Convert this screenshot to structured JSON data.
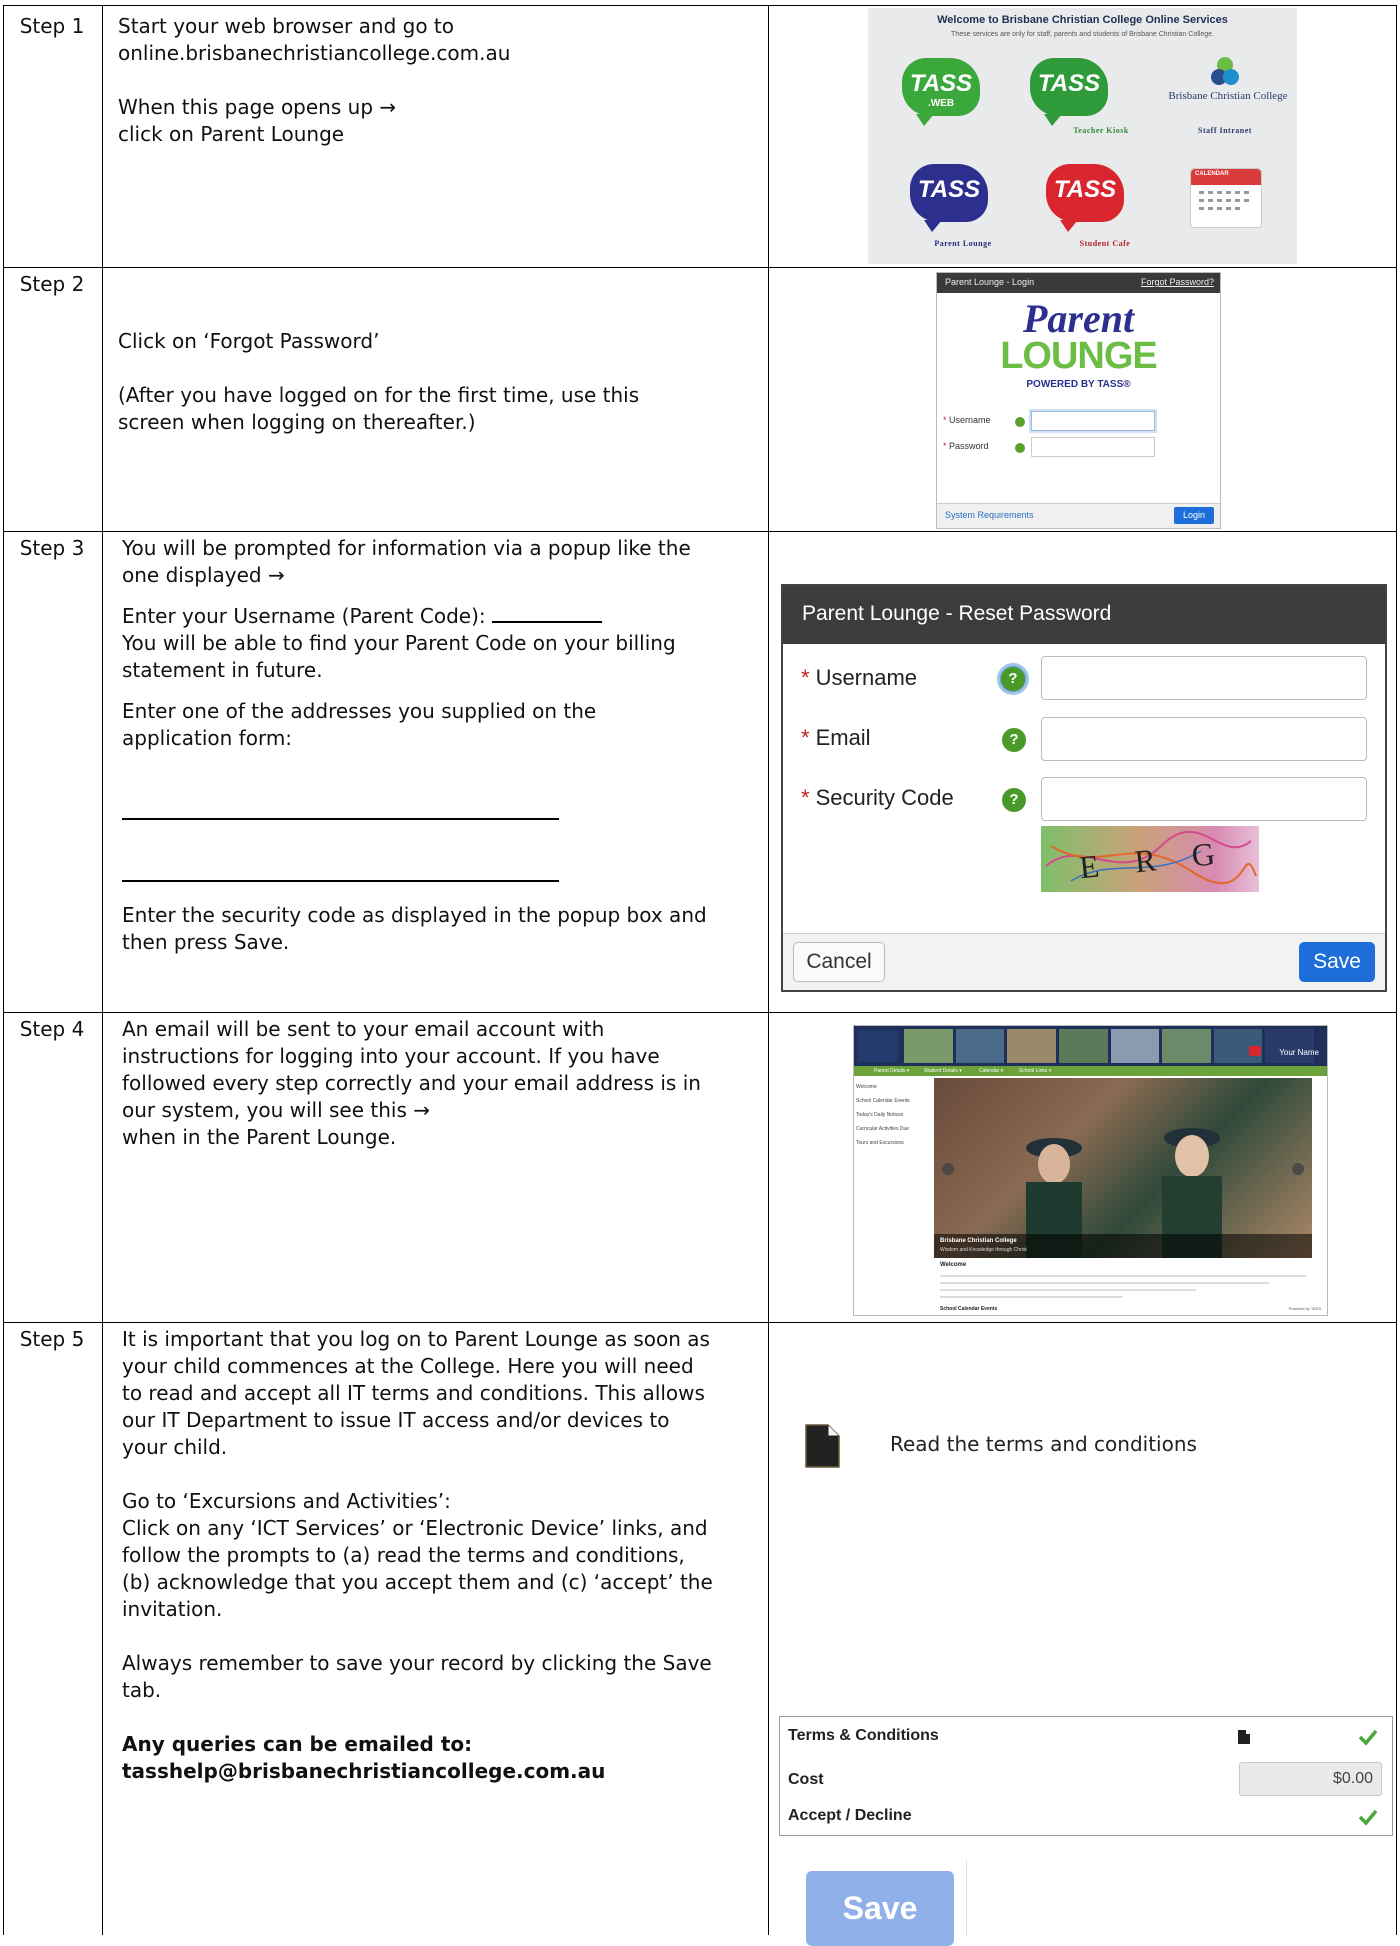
{
  "rows": [
    {
      "label": "Step 1",
      "lines": [
        "Start your web browser and go to",
        "online.brisbanechristiancollege.com.au",
        "When this page opens up →",
        "click on Parent Lounge"
      ]
    },
    {
      "label": "Step 2",
      "lines": [
        "Click on ‘Forgot Password’",
        "(After you have logged on for the first time, use this",
        "screen when logging on thereafter.)"
      ]
    },
    {
      "label": "Step 3",
      "lines": [
        "You will be prompted for information via a popup like the",
        "one displayed →",
        "Enter your Username (Parent Code):",
        "You will be able to find your Parent Code on your billing",
        "statement in future.",
        "Enter one of the addresses you supplied on the",
        "application form:",
        "Enter the security code as displayed in the popup box and",
        "then press Save."
      ]
    },
    {
      "label": "Step 4",
      "lines": [
        "An email will be sent to your email account with",
        "instructions for logging into your account.  If you have",
        "followed every step correctly and your email address is in",
        "our system, you will see this →",
        "when in the Parent Lounge."
      ]
    },
    {
      "label": "Step 5",
      "lines": [
        "It is important that you log on to Parent Lounge as soon as",
        "your child commences at the College. Here you will need",
        "to read and accept all IT terms and conditions. This allows",
        "our IT Department to issue IT access and/or devices to",
        "your child.",
        "Go to ‘Excursions and Activities’:",
        "Click on any ‘ICT Services’ or ‘Electronic Device’ links, and",
        "follow the prompts to (a) read the terms and conditions,",
        "(b) acknowledge that you accept them and (c) ‘accept’ the",
        "invitation.",
        "Always remember to save your record by clicking the Save",
        "tab.",
        "Any queries can be emailed to:",
        "tasshelp@brisbanechristiancollege.com.au"
      ]
    }
  ],
  "portal": {
    "title": "Welcome to Brisbane Christian College Online Services",
    "subtitle": "These services are only for staff, parents and students of Brisbane Christian College.",
    "tiles": [
      {
        "name": "TASS",
        "sub": ".WEB",
        "caption": "",
        "color": "#3aa83a"
      },
      {
        "name": "TASS",
        "sub": "",
        "caption": "Teacher Kiosk",
        "color": "#2e9a3a"
      },
      {
        "name": "Brisbane Christian College",
        "sub": "",
        "caption": "Staff Intranet",
        "color": "#2b3b6a"
      },
      {
        "name": "TASS",
        "sub": "",
        "caption": "Parent Lounge",
        "color": "#2d2f8f"
      },
      {
        "name": "TASS",
        "sub": "",
        "caption": "Student Cafe",
        "color": "#d9262e"
      },
      {
        "name": "CALENDAR",
        "sub": "",
        "caption": "",
        "color": "#d93a3a"
      }
    ]
  },
  "login": {
    "header_title": "Parent Lounge - Login",
    "forgot_link": "Forgot Password?",
    "logo_line1": "Parent",
    "logo_line2": "LOUNGE",
    "powered": "POWERED BY TASS®",
    "username_label": "Username",
    "password_label": "Password",
    "sysreq_link": "System Requirements",
    "login_button": "Login"
  },
  "reset": {
    "title": "Parent Lounge - Reset Password",
    "username_label": "Username",
    "email_label": "Email",
    "security_label": "Security Code",
    "captcha_text": "E R G 8",
    "cancel_button": "Cancel",
    "save_button": "Save"
  },
  "lounge": {
    "user_name": "Your Name",
    "nav": [
      "Parent Details ▾",
      "Student Details ▾",
      "Calendar ▾",
      "School Links ▾"
    ],
    "side": [
      "Welcome",
      "School Calendar Events",
      "Today's Daily Notices",
      "Curricular Activities Due",
      "Tours and Excursions"
    ],
    "caption_title": "Brisbane Christian College",
    "caption_sub": "Wisdom and Knowledge through Christ",
    "welcome_heading": "Welcome",
    "calendar_heading": "School Calendar Events",
    "powered": "Powered by TASS"
  },
  "step5": {
    "read_terms": "Read the terms and conditions",
    "tc_label": "Terms & Conditions",
    "cost_label": "Cost",
    "cost_value": "$0.00",
    "accept_label": "Accept / Decline",
    "save_button": "Save"
  }
}
